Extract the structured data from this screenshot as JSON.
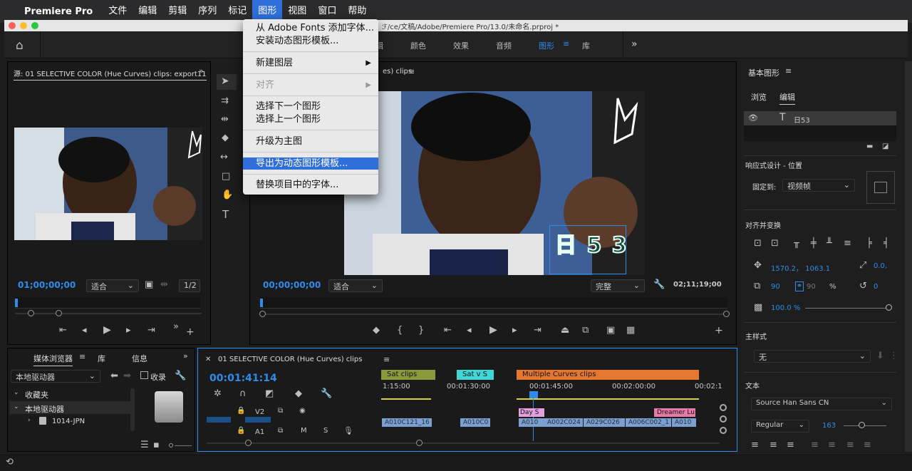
{
  "menubar": {
    "app_name": "Premiere Pro",
    "items": [
      "文件",
      "编辑",
      "剪辑",
      "序列",
      "标记",
      "图形",
      "视图",
      "窗口",
      "帮助"
    ],
    "active": "图形"
  },
  "window": {
    "title_path": "ℱ/ce/文稿/Adobe/Premiere Pro/13.0/未命名.prproj *"
  },
  "workspaces": [
    "编辑",
    "颜色",
    "效果",
    "音频",
    "图形",
    "库"
  ],
  "workspace_active": "图形",
  "graphics_menu": {
    "items": [
      {
        "label": "从 Adobe Fonts 添加字体..."
      },
      {
        "label": "安装动态图形模板..."
      },
      {
        "label": "新建图层",
        "submenu": true
      },
      {
        "label": "对齐",
        "submenu": true,
        "disabled": true
      },
      {
        "label": "选择下一个图形"
      },
      {
        "label": "选择上一个图形"
      },
      {
        "label": "升级为主图"
      },
      {
        "label": "导出为动态图形模板...",
        "highlighted": true
      },
      {
        "label": "替换项目中的字体..."
      }
    ]
  },
  "source_monitor": {
    "title": "源: 01 SELECTIVE COLOR (Hue Curves) clips: export11",
    "timecode": "01;00;00;00",
    "fit": "适合",
    "resolution": "1/2"
  },
  "program_monitor": {
    "title_suffix": "es) clips",
    "timecode": "00;00;00;00",
    "fit": "适合",
    "quality": "完整",
    "duration": "02;11;19;00",
    "overlay_text": "日 5 3"
  },
  "project_panel": {
    "tabs": [
      "媒体浏览器",
      "库",
      "信息"
    ],
    "location": "本地驱动器",
    "collect_label": "收录",
    "tree": [
      "收藏夹",
      "本地驱动器",
      "1014-JPN"
    ]
  },
  "timeline": {
    "title": "01 SELECTIVE COLOR (Hue Curves) clips",
    "timecode": "00:01:41:14",
    "ruler": [
      "1:15:00",
      "00:01:30:00",
      "00:01:45:00",
      "00:02:00:00",
      "00:02:1"
    ],
    "tracks": {
      "v2": "V2",
      "a1": "A1",
      "mute": "M",
      "solo": "S"
    },
    "adjustment_clips": [
      "Sat clips",
      "Sat v S",
      "Multiple Curves clips"
    ],
    "v2_clips": [
      "Day S",
      "Dreamer Lu"
    ],
    "v1_clips": [
      "A010C121_16",
      "A010C0",
      "A010",
      "A002C024",
      "A029C026",
      "A006C002_1",
      "A010"
    ]
  },
  "essential_graphics": {
    "title": "基本图形",
    "tabs": [
      "浏览",
      "编辑"
    ],
    "layer_name": "日53",
    "responsive_label": "响应式设计 - 位置",
    "pin_label": "固定到:",
    "pin_value": "视频帧",
    "align_label": "对齐并变换",
    "position": "1570.2， 1063.1",
    "anchor": "0.0,",
    "scale": "90",
    "scale_h": "90",
    "scale_unit": "%",
    "rotation": "0",
    "opacity": "100.0 %",
    "master_style_label": "主样式",
    "master_style_value": "无",
    "text_label": "文本",
    "font": "Source Han Sans CN",
    "font_style": "Regular",
    "font_size": "163"
  },
  "colors": {
    "accent": "#2d8ceb",
    "menu_highlight": "#2f6fdb",
    "orange_clip": "#e8772e",
    "green_clip": "#8a9a3a",
    "cyan_clip": "#3fd6d6",
    "pink_clip": "#e87aa8"
  }
}
